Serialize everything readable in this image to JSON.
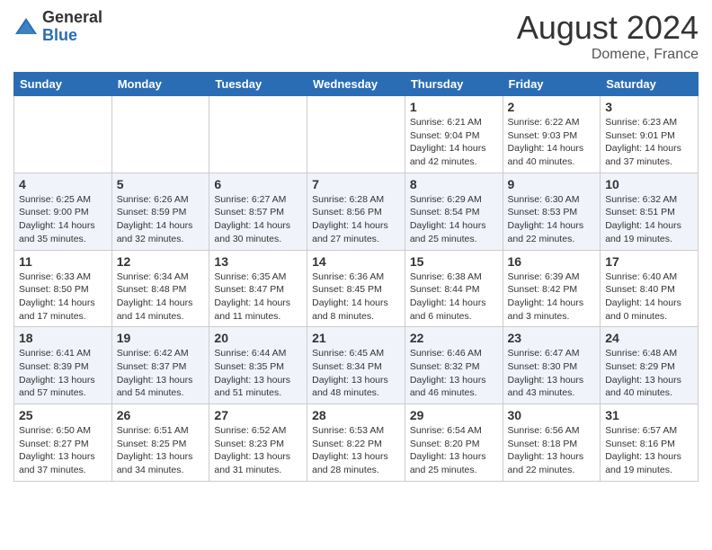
{
  "header": {
    "logo_general": "General",
    "logo_blue": "Blue",
    "month_year": "August 2024",
    "location": "Domene, France"
  },
  "days_of_week": [
    "Sunday",
    "Monday",
    "Tuesday",
    "Wednesday",
    "Thursday",
    "Friday",
    "Saturday"
  ],
  "weeks": [
    [
      {
        "day": "",
        "info": ""
      },
      {
        "day": "",
        "info": ""
      },
      {
        "day": "",
        "info": ""
      },
      {
        "day": "",
        "info": ""
      },
      {
        "day": "1",
        "info": "Sunrise: 6:21 AM\nSunset: 9:04 PM\nDaylight: 14 hours and 42 minutes."
      },
      {
        "day": "2",
        "info": "Sunrise: 6:22 AM\nSunset: 9:03 PM\nDaylight: 14 hours and 40 minutes."
      },
      {
        "day": "3",
        "info": "Sunrise: 6:23 AM\nSunset: 9:01 PM\nDaylight: 14 hours and 37 minutes."
      }
    ],
    [
      {
        "day": "4",
        "info": "Sunrise: 6:25 AM\nSunset: 9:00 PM\nDaylight: 14 hours and 35 minutes."
      },
      {
        "day": "5",
        "info": "Sunrise: 6:26 AM\nSunset: 8:59 PM\nDaylight: 14 hours and 32 minutes."
      },
      {
        "day": "6",
        "info": "Sunrise: 6:27 AM\nSunset: 8:57 PM\nDaylight: 14 hours and 30 minutes."
      },
      {
        "day": "7",
        "info": "Sunrise: 6:28 AM\nSunset: 8:56 PM\nDaylight: 14 hours and 27 minutes."
      },
      {
        "day": "8",
        "info": "Sunrise: 6:29 AM\nSunset: 8:54 PM\nDaylight: 14 hours and 25 minutes."
      },
      {
        "day": "9",
        "info": "Sunrise: 6:30 AM\nSunset: 8:53 PM\nDaylight: 14 hours and 22 minutes."
      },
      {
        "day": "10",
        "info": "Sunrise: 6:32 AM\nSunset: 8:51 PM\nDaylight: 14 hours and 19 minutes."
      }
    ],
    [
      {
        "day": "11",
        "info": "Sunrise: 6:33 AM\nSunset: 8:50 PM\nDaylight: 14 hours and 17 minutes."
      },
      {
        "day": "12",
        "info": "Sunrise: 6:34 AM\nSunset: 8:48 PM\nDaylight: 14 hours and 14 minutes."
      },
      {
        "day": "13",
        "info": "Sunrise: 6:35 AM\nSunset: 8:47 PM\nDaylight: 14 hours and 11 minutes."
      },
      {
        "day": "14",
        "info": "Sunrise: 6:36 AM\nSunset: 8:45 PM\nDaylight: 14 hours and 8 minutes."
      },
      {
        "day": "15",
        "info": "Sunrise: 6:38 AM\nSunset: 8:44 PM\nDaylight: 14 hours and 6 minutes."
      },
      {
        "day": "16",
        "info": "Sunrise: 6:39 AM\nSunset: 8:42 PM\nDaylight: 14 hours and 3 minutes."
      },
      {
        "day": "17",
        "info": "Sunrise: 6:40 AM\nSunset: 8:40 PM\nDaylight: 14 hours and 0 minutes."
      }
    ],
    [
      {
        "day": "18",
        "info": "Sunrise: 6:41 AM\nSunset: 8:39 PM\nDaylight: 13 hours and 57 minutes."
      },
      {
        "day": "19",
        "info": "Sunrise: 6:42 AM\nSunset: 8:37 PM\nDaylight: 13 hours and 54 minutes."
      },
      {
        "day": "20",
        "info": "Sunrise: 6:44 AM\nSunset: 8:35 PM\nDaylight: 13 hours and 51 minutes."
      },
      {
        "day": "21",
        "info": "Sunrise: 6:45 AM\nSunset: 8:34 PM\nDaylight: 13 hours and 48 minutes."
      },
      {
        "day": "22",
        "info": "Sunrise: 6:46 AM\nSunset: 8:32 PM\nDaylight: 13 hours and 46 minutes."
      },
      {
        "day": "23",
        "info": "Sunrise: 6:47 AM\nSunset: 8:30 PM\nDaylight: 13 hours and 43 minutes."
      },
      {
        "day": "24",
        "info": "Sunrise: 6:48 AM\nSunset: 8:29 PM\nDaylight: 13 hours and 40 minutes."
      }
    ],
    [
      {
        "day": "25",
        "info": "Sunrise: 6:50 AM\nSunset: 8:27 PM\nDaylight: 13 hours and 37 minutes."
      },
      {
        "day": "26",
        "info": "Sunrise: 6:51 AM\nSunset: 8:25 PM\nDaylight: 13 hours and 34 minutes."
      },
      {
        "day": "27",
        "info": "Sunrise: 6:52 AM\nSunset: 8:23 PM\nDaylight: 13 hours and 31 minutes."
      },
      {
        "day": "28",
        "info": "Sunrise: 6:53 AM\nSunset: 8:22 PM\nDaylight: 13 hours and 28 minutes."
      },
      {
        "day": "29",
        "info": "Sunrise: 6:54 AM\nSunset: 8:20 PM\nDaylight: 13 hours and 25 minutes."
      },
      {
        "day": "30",
        "info": "Sunrise: 6:56 AM\nSunset: 8:18 PM\nDaylight: 13 hours and 22 minutes."
      },
      {
        "day": "31",
        "info": "Sunrise: 6:57 AM\nSunset: 8:16 PM\nDaylight: 13 hours and 19 minutes."
      }
    ]
  ]
}
